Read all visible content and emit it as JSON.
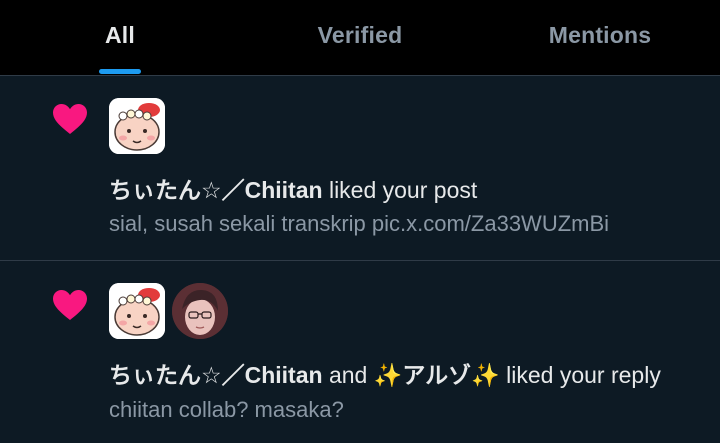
{
  "tabs": [
    {
      "label": "All",
      "active": true
    },
    {
      "label": "Verified",
      "active": false
    },
    {
      "label": "Mentions",
      "active": false
    }
  ],
  "colors": {
    "accent": "#1d9bf0",
    "heart": "#f91880",
    "background": "#0d1a24",
    "header_background": "#000000",
    "text_primary": "#e7e9ea",
    "text_secondary": "#8b98a5"
  },
  "notifications": [
    {
      "icon": "heart-icon",
      "user1": "ちぃたん☆／Chiitan",
      "connector": "",
      "user2": "",
      "action": " liked your post",
      "snippet": "sial, susah sekali transkrip pic.x.com/Za33WUZmBi"
    },
    {
      "icon": "heart-icon",
      "user1": "ちぃたん☆／Chiitan",
      "connector": " and ",
      "user2": "✨アルゾ✨",
      "action": " liked your reply",
      "snippet": "chiitan collab? masaka?"
    }
  ]
}
